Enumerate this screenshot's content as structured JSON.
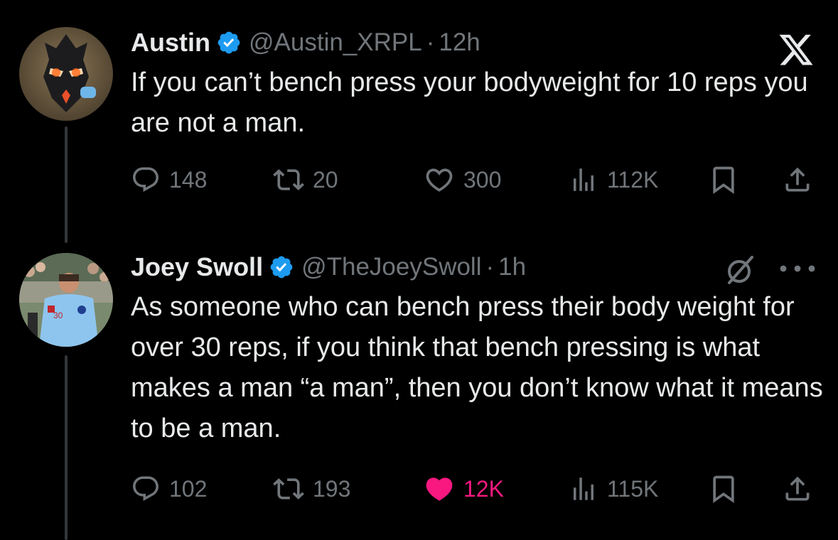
{
  "tweets": [
    {
      "name": "Austin",
      "handle": "@Austin_XRPL",
      "separator": "·",
      "time": "12h",
      "text": "If you can’t bench press your bodyweight for 10 reps you are not a man.",
      "replies": "148",
      "reposts": "20",
      "likes": "300",
      "views": "112K",
      "liked": false,
      "corner_icon": "x-logo-icon"
    },
    {
      "name": "Joey Swoll",
      "handle": "@TheJoeySwoll",
      "separator": "·",
      "time": "1h",
      "text": "As someone who can bench press their body weight for over 30 reps, if you think that bench pressing is what makes a man “a man”, then you don’t know what it means to be a man.",
      "replies": "102",
      "reposts": "193",
      "likes": "12K",
      "views": "115K",
      "liked": true,
      "corner_icon": "grok-icon",
      "more_icon": "more-icon"
    }
  ],
  "colors": {
    "background": "#000000",
    "text": "#e7e9ea",
    "muted": "#71767b",
    "verified": "#1d9bf0",
    "like_active": "#f91880"
  }
}
